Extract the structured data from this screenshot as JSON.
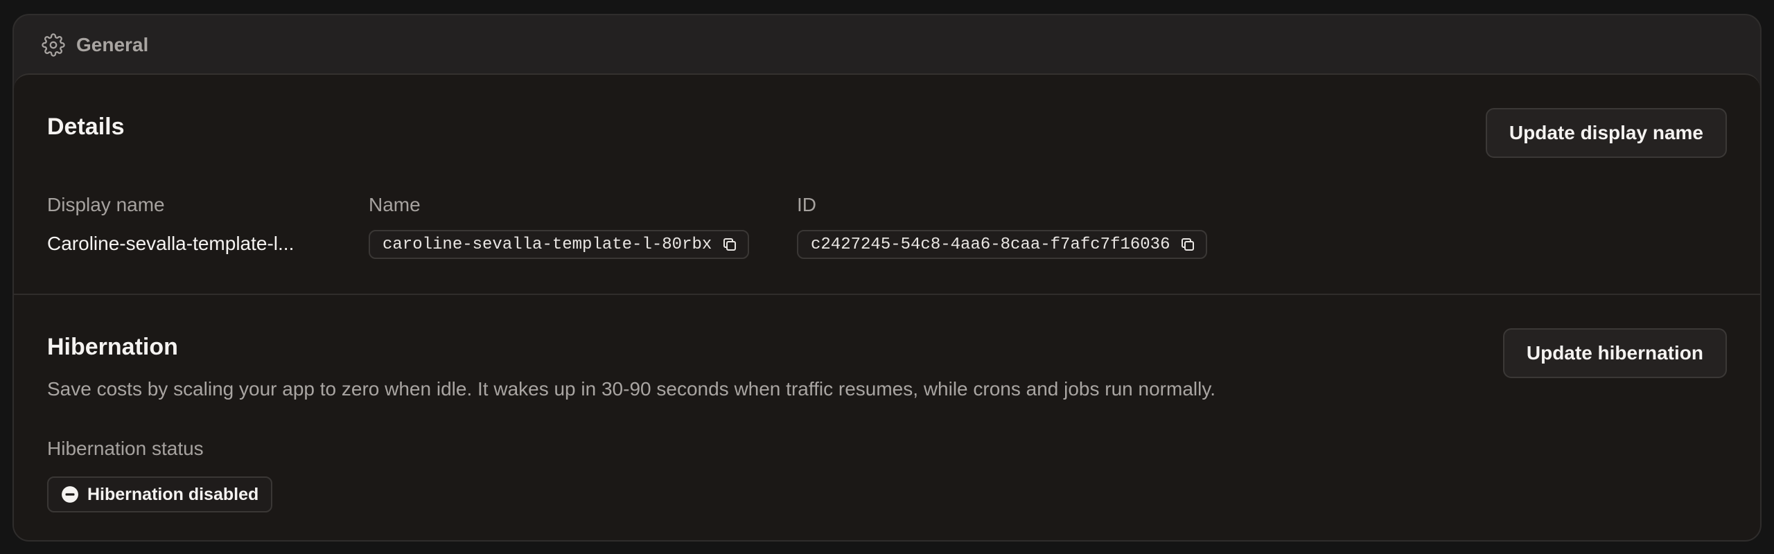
{
  "panel": {
    "title": "General",
    "icon": "gear-icon"
  },
  "details": {
    "heading": "Details",
    "button_label": "Update display name",
    "display_name_label": "Display name",
    "display_name_value": "Caroline-sevalla-template-l...",
    "name_label": "Name",
    "name_value": "caroline-sevalla-template-l-80rbx",
    "id_label": "ID",
    "id_value": "c2427245-54c8-4aa6-8caa-f7afc7f16036"
  },
  "hibernation": {
    "heading": "Hibernation",
    "button_label": "Update hibernation",
    "description": "Save costs by scaling your app to zero when idle. It wakes up in 30-90 seconds when traffic resumes, while crons and jobs run normally.",
    "status_label": "Hibernation status",
    "status_value": "Hibernation disabled",
    "status_icon": "minus-circle-icon"
  },
  "colors": {
    "background": "#141414",
    "panel": "#232121",
    "body": "#1b1816",
    "muted_text": "#a6a29f",
    "text": "#f5f3f1"
  }
}
